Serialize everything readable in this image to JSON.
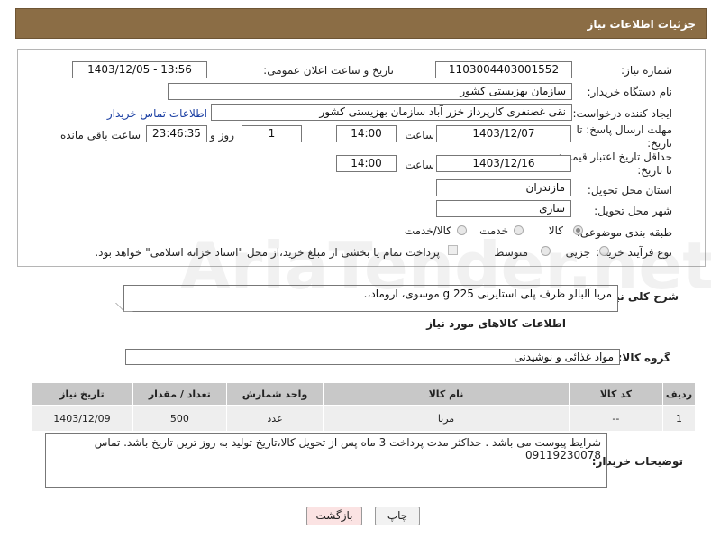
{
  "header": {
    "title": "جزئیات اطلاعات نیاز"
  },
  "form": {
    "need_number": {
      "label": "شماره نیاز:",
      "value": "1103004403001552"
    },
    "announce": {
      "label": "تاریخ و ساعت اعلان عمومی:",
      "value": "1403/12/05 - 13:56"
    },
    "buyer_org": {
      "label": "نام دستگاه خریدار:",
      "value": "سازمان بهزیستی کشور"
    },
    "creator": {
      "label": "ایجاد کننده درخواست:",
      "value": "نقی غضنفری کارپرداز خزر آباد سازمان بهزیستی کشور",
      "contact_link": "اطلاعات تماس خریدار"
    },
    "reply_deadline": {
      "label": "مهلت ارسال پاسخ: تا تاریخ:",
      "date": "1403/12/07",
      "time_label": "ساعت",
      "time": "14:00",
      "days": "1",
      "days_label": "روز و",
      "remaining": "23:46:35",
      "remaining_label": "ساعت باقی مانده"
    },
    "price_validity": {
      "label": "حداقل تاریخ اعتبار قیمت: تا تاریخ:",
      "date": "1403/12/16",
      "time_label": "ساعت",
      "time": "14:00"
    },
    "province": {
      "label": "استان محل تحویل:",
      "value": "مازندران"
    },
    "city": {
      "label": "شهر محل تحویل:",
      "value": "ساری"
    },
    "category": {
      "label": "طبقه بندی موضوعی:",
      "options": [
        "کالا",
        "خدمت",
        "کالا/خدمت"
      ],
      "selected": "کالا"
    },
    "process": {
      "label": "نوع فرآیند خرید :",
      "options": [
        "جزیی",
        "متوسط"
      ],
      "selected": "جزیی",
      "note": "پرداخت تمام یا بخشی از مبلغ خرید،از محل \"اسناد خزانه اسلامی\" خواهد بود."
    }
  },
  "summary": {
    "label": "شرح کلی نیاز:",
    "value": "مربا آلبالو ظرف پلی استایرنی 225 g موسوی، اروماد،."
  },
  "goods": {
    "section_title": "اطلاعات کالاهای مورد نیاز",
    "group_label": "گروه کالا:",
    "group_value": "مواد غذائی و نوشیدنی",
    "columns": [
      "ردیف",
      "کد کالا",
      "نام کالا",
      "واحد شمارش",
      "تعداد / مقدار",
      "تاریخ نیاز"
    ],
    "rows": [
      [
        "1",
        "--",
        "مربا",
        "عدد",
        "500",
        "1403/12/09"
      ]
    ]
  },
  "buyer_notes": {
    "label": "توضیحات خریدار:",
    "value": "شرایط پیوست می باشد . حداکثر مدت پرداخت 3 ماه پس از تحویل کالا،تاریخ تولید به روز ترین تاریخ باشد. تماس 09119230078"
  },
  "buttons": {
    "print": "چاپ",
    "back": "بازگشت"
  },
  "watermark": "AriaTender.net",
  "colors": {
    "header_bg": "#8b6d45",
    "table_header_bg": "#c8c8c8",
    "back_button_bg": "#fbe3e3"
  }
}
